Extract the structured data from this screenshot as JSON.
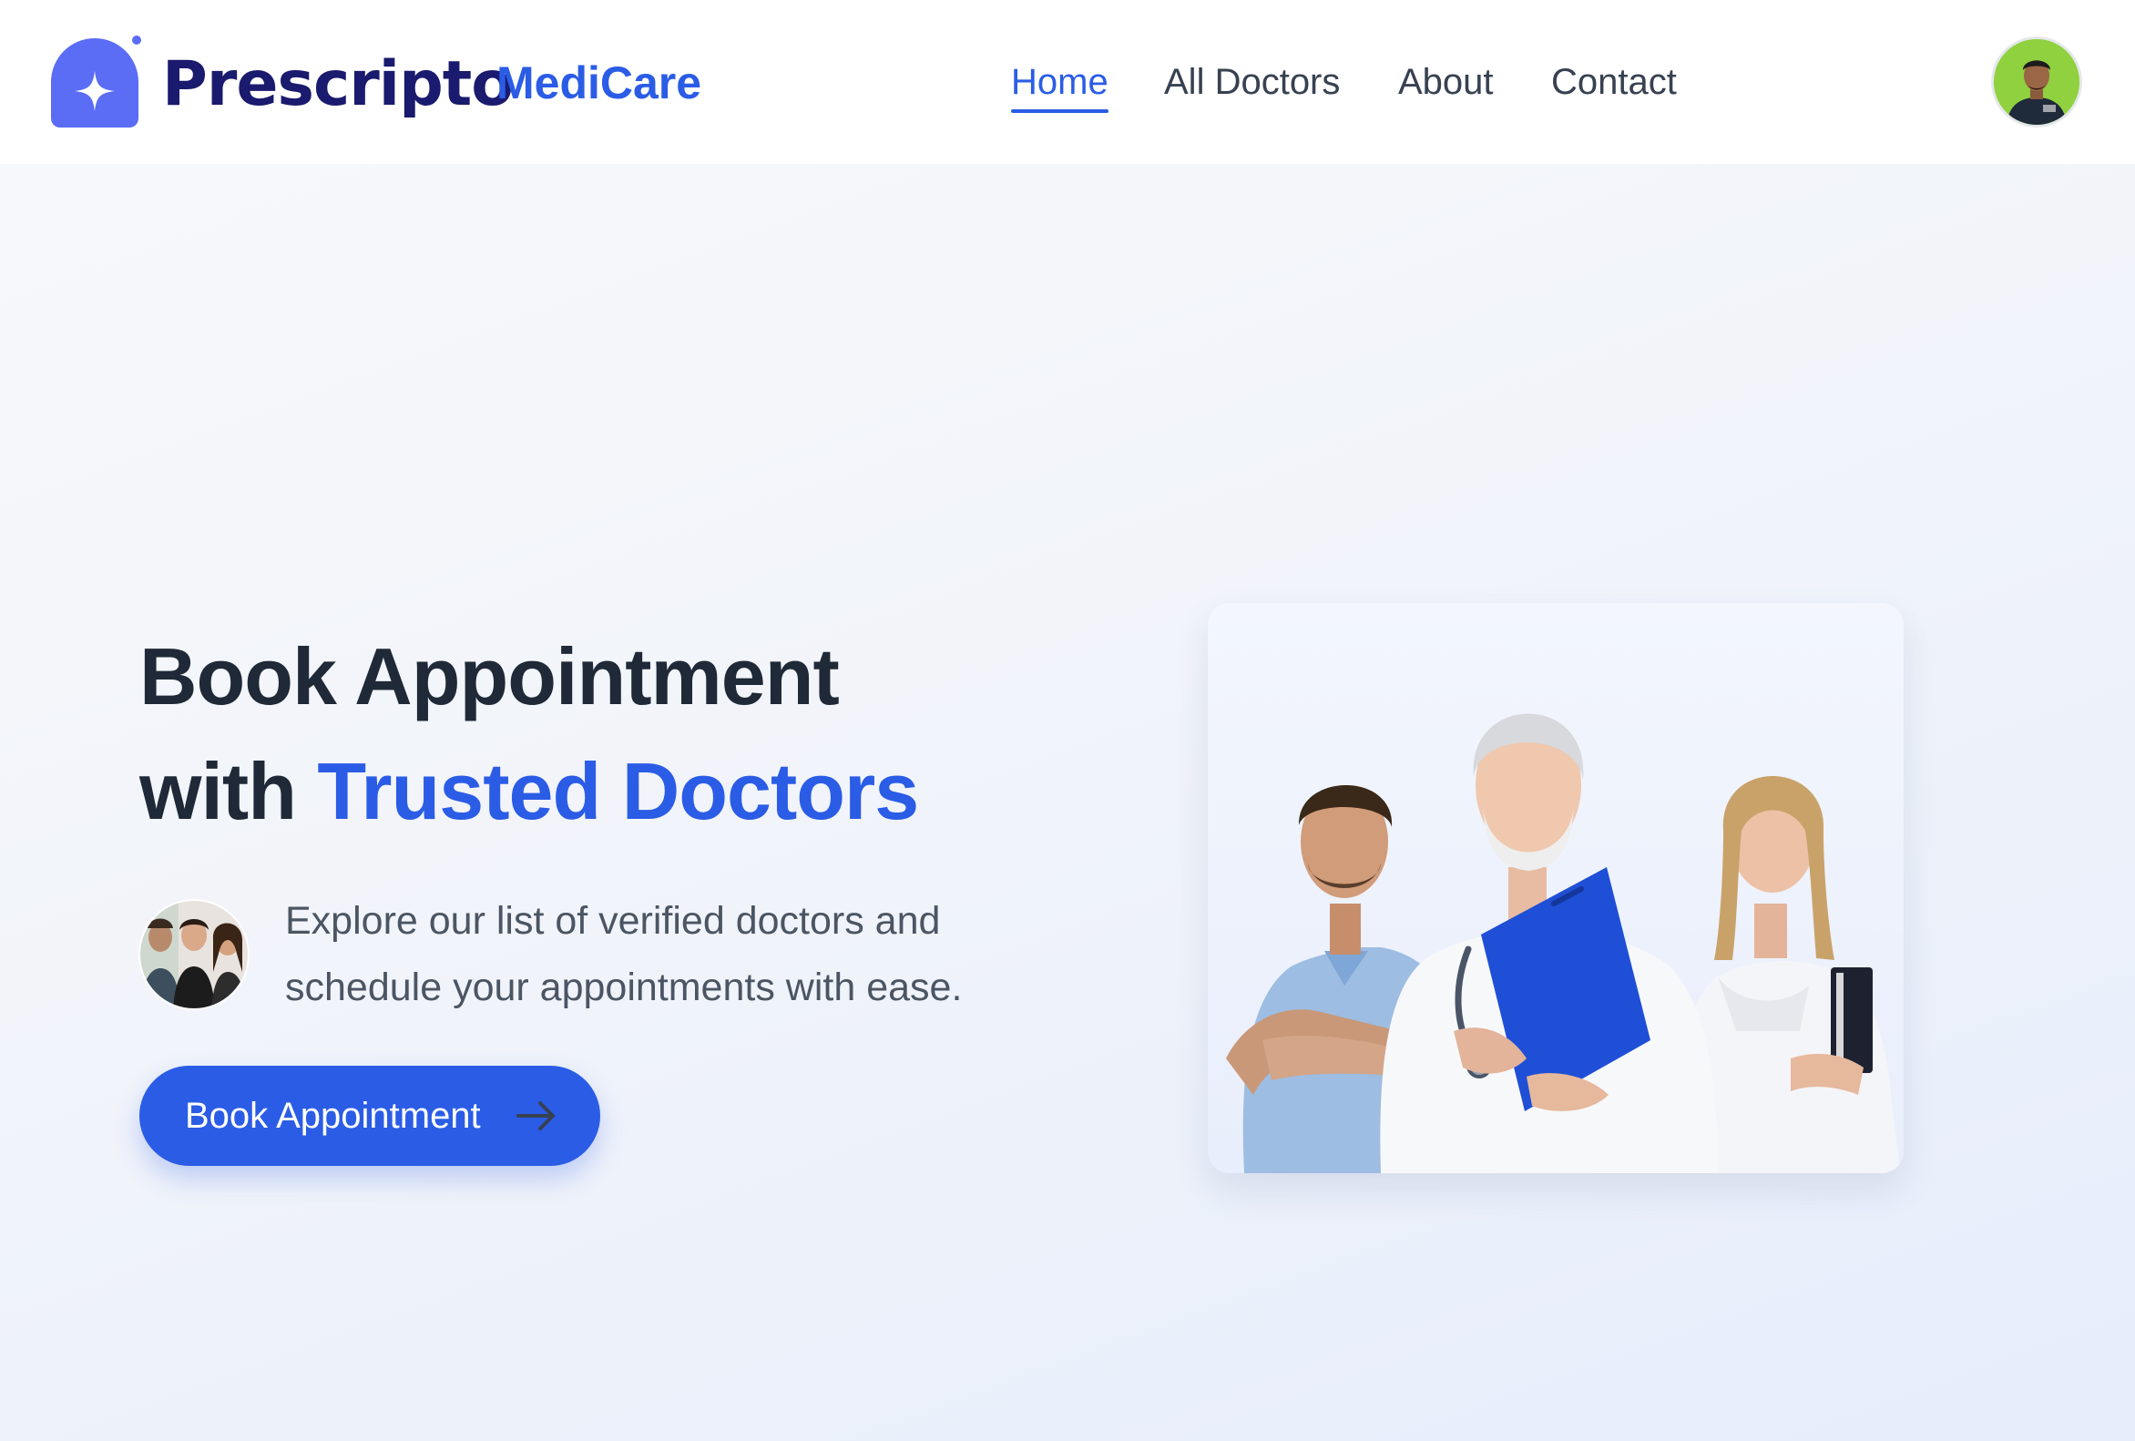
{
  "brand": {
    "logo_name": "Prescripto",
    "subtitle": "MediCare",
    "logo_color": "#5b6cf5"
  },
  "nav": {
    "items": [
      {
        "label": "Home",
        "active": true
      },
      {
        "label": "All Doctors",
        "active": false
      },
      {
        "label": "About",
        "active": false
      },
      {
        "label": "Contact",
        "active": false
      }
    ]
  },
  "user": {
    "avatar_icon": "user-avatar-icon"
  },
  "hero": {
    "title_line1": "Book Appointment",
    "title_line2_prefix": "with ",
    "title_line2_accent": "Trusted Doctors",
    "description": "Explore our list of verified doctors and schedule your appointments with ease.",
    "cta_label": "Book Appointment",
    "cta_icon": "arrow-right-icon",
    "image_icon": "doctors-group-image"
  },
  "colors": {
    "accent": "#2b5ce6",
    "heading": "#1f2937",
    "text": "#4b5563"
  }
}
